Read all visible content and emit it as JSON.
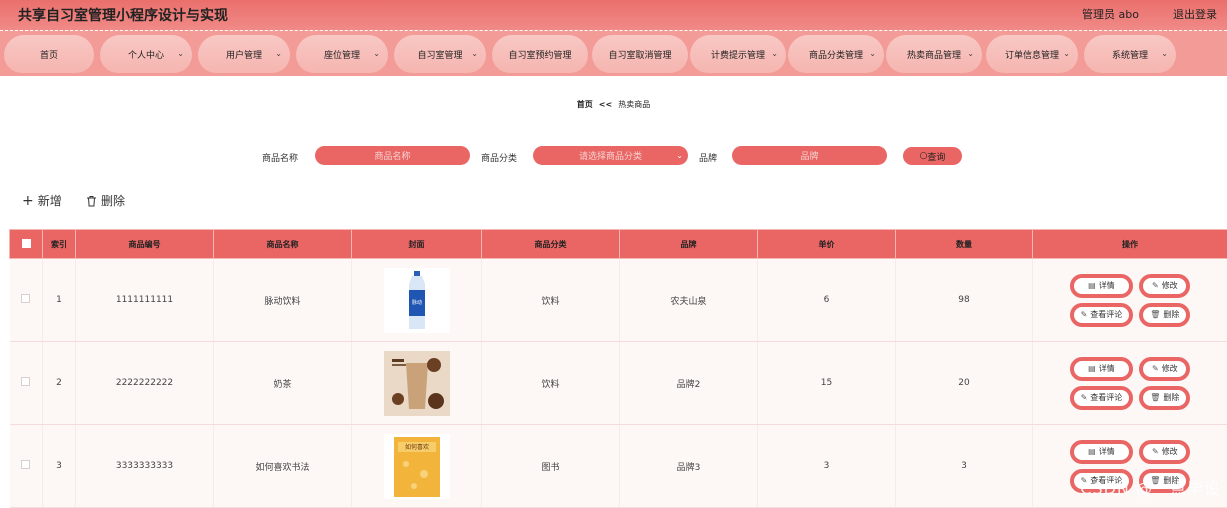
{
  "header": {
    "title": "共享自习室管理小程序设计与实现",
    "user": "管理员 abo",
    "logout": "退出登录",
    "colors": {
      "primary": "#e96664",
      "nav": "#f39b97",
      "nav_item": "#f7c0bb"
    }
  },
  "nav": {
    "items": [
      {
        "label": "首页",
        "chevron": false
      },
      {
        "label": "个人中心",
        "chevron": true
      },
      {
        "label": "用户管理",
        "chevron": true
      },
      {
        "label": "座位管理",
        "chevron": true
      },
      {
        "label": "自习室管理",
        "chevron": true
      },
      {
        "label": "自习室预约管理",
        "chevron": false
      },
      {
        "label": "自习室取消管理",
        "chevron": false
      },
      {
        "label": "计费提示管理",
        "chevron": true
      },
      {
        "label": "商品分类管理",
        "chevron": true
      },
      {
        "label": "热卖商品管理",
        "chevron": true
      },
      {
        "label": "订单信息管理",
        "chevron": true
      },
      {
        "label": "系统管理",
        "chevron": true
      }
    ]
  },
  "breadcrumb": {
    "home": "首页",
    "sep": "<<",
    "current": "热卖商品"
  },
  "search": {
    "name_label": "商品名称",
    "name_placeholder": "商品名称",
    "category_label": "商品分类",
    "category_placeholder": "请选择商品分类",
    "brand_label": "品牌",
    "brand_placeholder": "品牌",
    "query_label": "查询"
  },
  "toolbar": {
    "add_label": "新增",
    "delete_label": "删除"
  },
  "table": {
    "headers": [
      "索引",
      "商品编号",
      "商品名称",
      "封面",
      "商品分类",
      "品牌",
      "单价",
      "数量",
      "操作"
    ],
    "rows": [
      {
        "index": "1",
        "code": "1111111111",
        "name": "脉动饮料",
        "category": "饮料",
        "brand": "农夫山泉",
        "price": "6",
        "qty": "98",
        "cover": "bottle"
      },
      {
        "index": "2",
        "code": "2222222222",
        "name": "奶茶",
        "category": "饮料",
        "brand": "品牌2",
        "price": "15",
        "qty": "20",
        "cover": "milktea"
      },
      {
        "index": "3",
        "code": "3333333333",
        "name": "如何喜欢书法",
        "category": "图书",
        "brand": "品牌3",
        "price": "3",
        "qty": "3",
        "cover": "book"
      }
    ],
    "actions": {
      "detail": "详情",
      "edit": "修改",
      "comments": "查看评论",
      "delete": "删除"
    }
  },
  "watermark": "CSDN @一点毕设"
}
